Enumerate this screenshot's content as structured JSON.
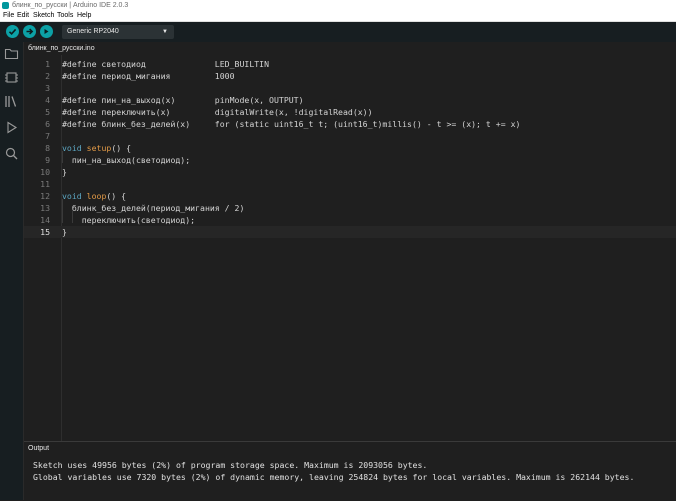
{
  "window": {
    "title": "блинк_по_русски | Arduino IDE 2.0.3"
  },
  "menu": [
    "File",
    "Edit",
    "Sketch",
    "Tools",
    "Help"
  ],
  "toolbar": {
    "board": "Generic RP2040"
  },
  "sidebar": {
    "icons": [
      "folder-icon",
      "board-manager-icon",
      "library-icon",
      "debug-icon",
      "search-icon"
    ]
  },
  "tab": {
    "label": "блинк_по_русски.ino"
  },
  "editor": {
    "active_line": 15,
    "lines": [
      {
        "n": "1",
        "code": "#define светодиод              LED_BUILTIN"
      },
      {
        "n": "2",
        "code": "#define период_мигания         1000"
      },
      {
        "n": "3",
        "code": ""
      },
      {
        "n": "4",
        "code": "#define пин_на_выход(x)        pinMode(x, OUTPUT)"
      },
      {
        "n": "5",
        "code": "#define переключить(x)         digitalWrite(x, !digitalRead(x))"
      },
      {
        "n": "6",
        "code": "#define блинк_без_делей(x)     for (static uint16_t t; (uint16_t)millis() - t >= (x); t += x)"
      },
      {
        "n": "7",
        "code": ""
      },
      {
        "n": "8",
        "code": "void setup() {"
      },
      {
        "n": "9",
        "code": "  пин_на_выход(светодиод);"
      },
      {
        "n": "10",
        "code": "}"
      },
      {
        "n": "11",
        "code": ""
      },
      {
        "n": "12",
        "code": "void loop() {"
      },
      {
        "n": "13",
        "code": "  блинк_без_делей(период_мигания / 2)"
      },
      {
        "n": "14",
        "code": "    переключить(светодиод);"
      },
      {
        "n": "15",
        "code": "}"
      }
    ]
  },
  "output": {
    "title": "Output",
    "lines": [
      "Sketch uses 49956 bytes (2%) of program storage space. Maximum is 2093056 bytes.",
      "Global variables use 7320 bytes (2%) of dynamic memory, leaving 254824 bytes for local variables. Maximum is 262144 bytes."
    ]
  },
  "colors": {
    "accent": "#0ca1a6",
    "keyword": "#5da7c3",
    "function": "#e29a47",
    "background": "#1f1f1f"
  }
}
